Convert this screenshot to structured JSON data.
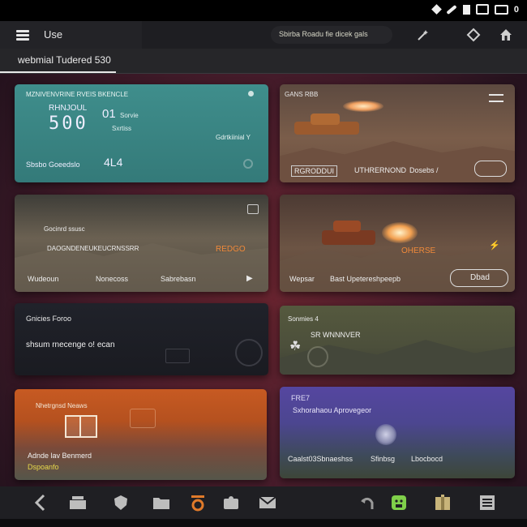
{
  "statusbar": {
    "indicator": "0"
  },
  "appbar": {
    "title": "Use",
    "search_text": "Sbirba Roadu fie dicek gals"
  },
  "tabbar": {
    "active_tab": "webmial  Tudered 530"
  },
  "cards": {
    "card1": {
      "header": "MZNIVENVRINE RVEIS BKENCLE",
      "label_a": "RHNJOUL",
      "big_value": "500",
      "value2": "01",
      "value2_sub": "Sorvie",
      "sub2": "Sxrtiss",
      "mid_right": "Gdrtkiinial Y",
      "footer_left": "Sbsbo Goeedslo",
      "footer_value": "4L4"
    },
    "card2": {
      "header": "GANS RBB",
      "footer_a": "RGRODDUI",
      "footer_b": "UTHRERNOND",
      "footer_c": "Dosebs /"
    },
    "card3": {
      "label_a": "Gocinrd ssusc",
      "label_b": "DAOGNDENEUKEUCRNSSRR",
      "badge": "REDGO",
      "footer_left": "Wudeoun",
      "footer_mid": "Nonecoss",
      "footer_right": "Sabrebasn"
    },
    "card4": {
      "badge": "OHERSE",
      "footer_left": "Wepsar",
      "footer_mid": "Bast Upetereshpeepb",
      "footer_right": "Dbad"
    },
    "card5": {
      "header": "Gnicies Foroo",
      "label": "shsum rnecenge o! ecan"
    },
    "card6": {
      "header": "Sonmies 4",
      "label": "SR WNNNVER"
    },
    "card7": {
      "header": "Nhetrgnsd Neaws",
      "footer_a": "Adnde lav Benmerd",
      "footer_b": "Dspoanfo"
    },
    "card8": {
      "header": "FRE7",
      "label": "Sxhorahaou Aprovegeor",
      "footer_a": "Caalst03Sbnaeshss",
      "footer_b": "Sfinbsg",
      "footer_c": "Lbocbocd"
    }
  },
  "colors": {
    "teal_card": "#3f8e8c",
    "accent_yellow": "#e8d84a",
    "accent_orange": "#e07a2a",
    "green_icon": "#7fcf4a"
  },
  "icons": {
    "navbar": [
      "back-icon",
      "inbox-icon",
      "shield-icon",
      "folder-icon",
      "record-icon",
      "puzzle-icon",
      "mail-icon",
      "undo-icon",
      "android-icon",
      "package-icon",
      "list-icon"
    ]
  }
}
